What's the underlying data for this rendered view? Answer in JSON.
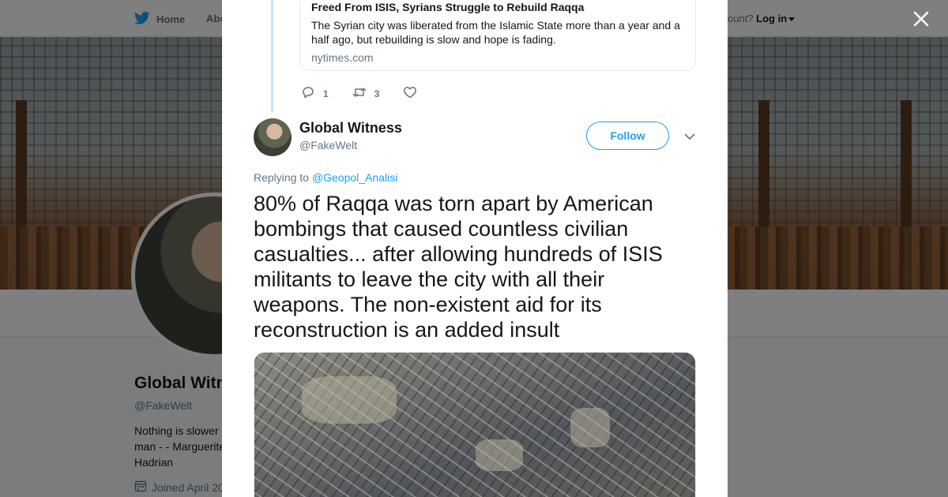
{
  "topnav": {
    "home_label": "Home",
    "about_label": "Abo",
    "account_prompt": "ccount?",
    "login_label": "Log in"
  },
  "profile": {
    "name": "Global Witn",
    "handle": "@FakeWelt",
    "bio": "Nothing is slower man - - Marguerite Hadrian",
    "joined": "Joined April 20"
  },
  "modal": {
    "link_card": {
      "title": "Freed From ISIS, Syrians Struggle to Rebuild Raqqa",
      "description": "The Syrian city was liberated from the Islamic State more than a year and a half ago, but rebuilding is slow and hope is fading.",
      "domain": "nytimes.com"
    },
    "actions": {
      "reply_count": "1",
      "retweet_count": "3"
    },
    "tweet": {
      "author_name": "Global Witness",
      "author_handle": "@FakeWelt",
      "follow_label": "Follow",
      "replying_prefix": "Replying to",
      "replying_to": "@Geopol_Analisi",
      "text": "80% of Raqqa was torn apart by American bombings that caused countless civilian casualties... after allowing hundreds of ISIS militants to leave the city with all their weapons.  The non-existent aid for its reconstruction is an added insult"
    }
  },
  "icons": {
    "brand": "twitter-bird-icon",
    "close": "close-icon",
    "reply": "reply-icon",
    "retweet": "retweet-icon",
    "like": "heart-icon",
    "more": "chevron-down-icon",
    "calendar": "calendar-icon"
  },
  "colors": {
    "brand_blue": "#1da1f2",
    "text_primary": "#14171a",
    "text_secondary": "#657786",
    "thread_line": "#cce4f6"
  }
}
